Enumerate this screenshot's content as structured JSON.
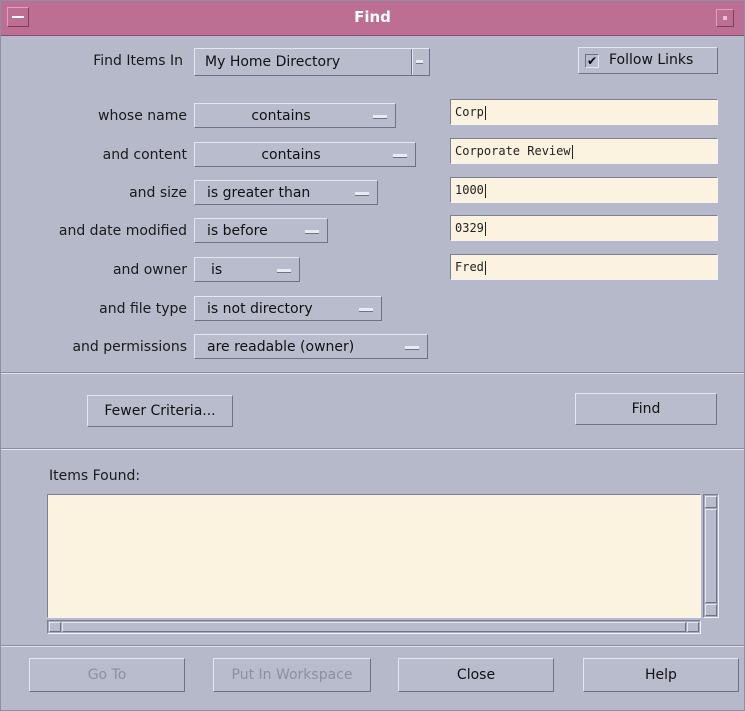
{
  "window": {
    "title": "Find"
  },
  "find_in": {
    "label": "Find Items In",
    "value": "My Home Directory"
  },
  "follow_links": {
    "label": "Follow Links",
    "checked": true,
    "mark": "✔"
  },
  "criteria": [
    {
      "label": "whose name",
      "operator": "contains",
      "value": "Corp"
    },
    {
      "label": "and content",
      "operator": "contains",
      "value": "Corporate Review"
    },
    {
      "label": "and size",
      "operator": "is greater than",
      "value": "1000"
    },
    {
      "label": "and date modified",
      "operator": "is before",
      "value": "0329"
    },
    {
      "label": "and owner",
      "operator": "is",
      "value": "Fred"
    },
    {
      "label": "and file type",
      "operator": "is not directory"
    },
    {
      "label": "and permissions",
      "operator": "are readable (owner)"
    }
  ],
  "actions": {
    "fewer_criteria": "Fewer Criteria...",
    "find": "Find"
  },
  "results": {
    "label": "Items Found:",
    "items": []
  },
  "footer": {
    "go_to": "Go To",
    "put_in_workspace": "Put In Workspace",
    "close": "Close",
    "help": "Help"
  },
  "colors": {
    "titlebar": "#bd6f93",
    "background": "#b6b9ca",
    "field": "#fbf2e0"
  }
}
